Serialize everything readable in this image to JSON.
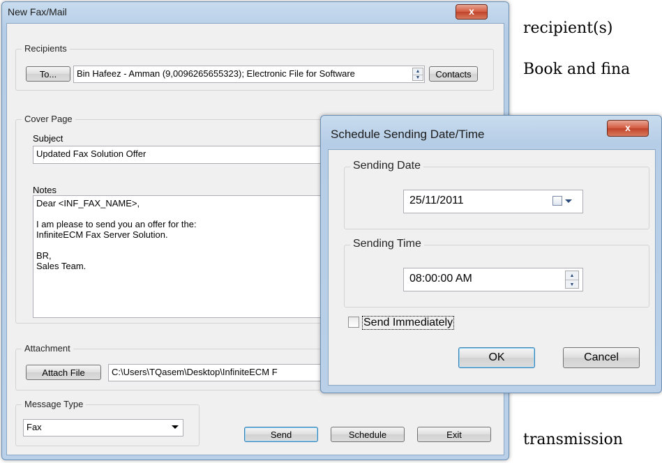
{
  "background_text": {
    "line1": "recipient(s)",
    "line2": "Book and fina",
    "line3": "transmission"
  },
  "main_window": {
    "title": "New Fax/Mail",
    "close_glyph": "x",
    "recipients": {
      "group_label": "Recipients",
      "to_button": "To...",
      "value": "Bin Hafeez - Amman (9,0096265655323); Electronic File for Software",
      "contacts_button": "Contacts"
    },
    "cover_page": {
      "group_label": "Cover Page",
      "subject_label": "Subject",
      "subject_value": "Updated Fax Solution Offer",
      "notes_label": "Notes",
      "notes_lines": [
        "Dear <INF_FAX_NAME>,",
        "",
        "I am please to send you an offer for the:",
        "InfiniteECM Fax Server Solution.",
        "",
        "BR,",
        "Sales Team."
      ]
    },
    "attachment": {
      "group_label": "Attachment",
      "attach_button": "Attach File",
      "path": "C:\\Users\\TQasem\\Desktop\\InfiniteECM F"
    },
    "message_type": {
      "group_label": "Message Type",
      "selected": "Fax"
    },
    "buttons": {
      "send": "Send",
      "schedule": "Schedule",
      "exit": "Exit"
    }
  },
  "schedule_dialog": {
    "title": "Schedule Sending Date/Time",
    "close_glyph": "x",
    "sending_date": {
      "group_label": "Sending Date",
      "value": "25/11/2011"
    },
    "sending_time": {
      "group_label": "Sending Time",
      "value": "08:00:00 AM"
    },
    "send_immediately_label": "Send Immediately",
    "send_immediately_checked": false,
    "ok_button": "OK",
    "cancel_button": "Cancel"
  },
  "colors": {
    "frame_blue": "#b9d0e8",
    "client_bg": "#f0f0f0",
    "close_red": "#c0442a"
  }
}
